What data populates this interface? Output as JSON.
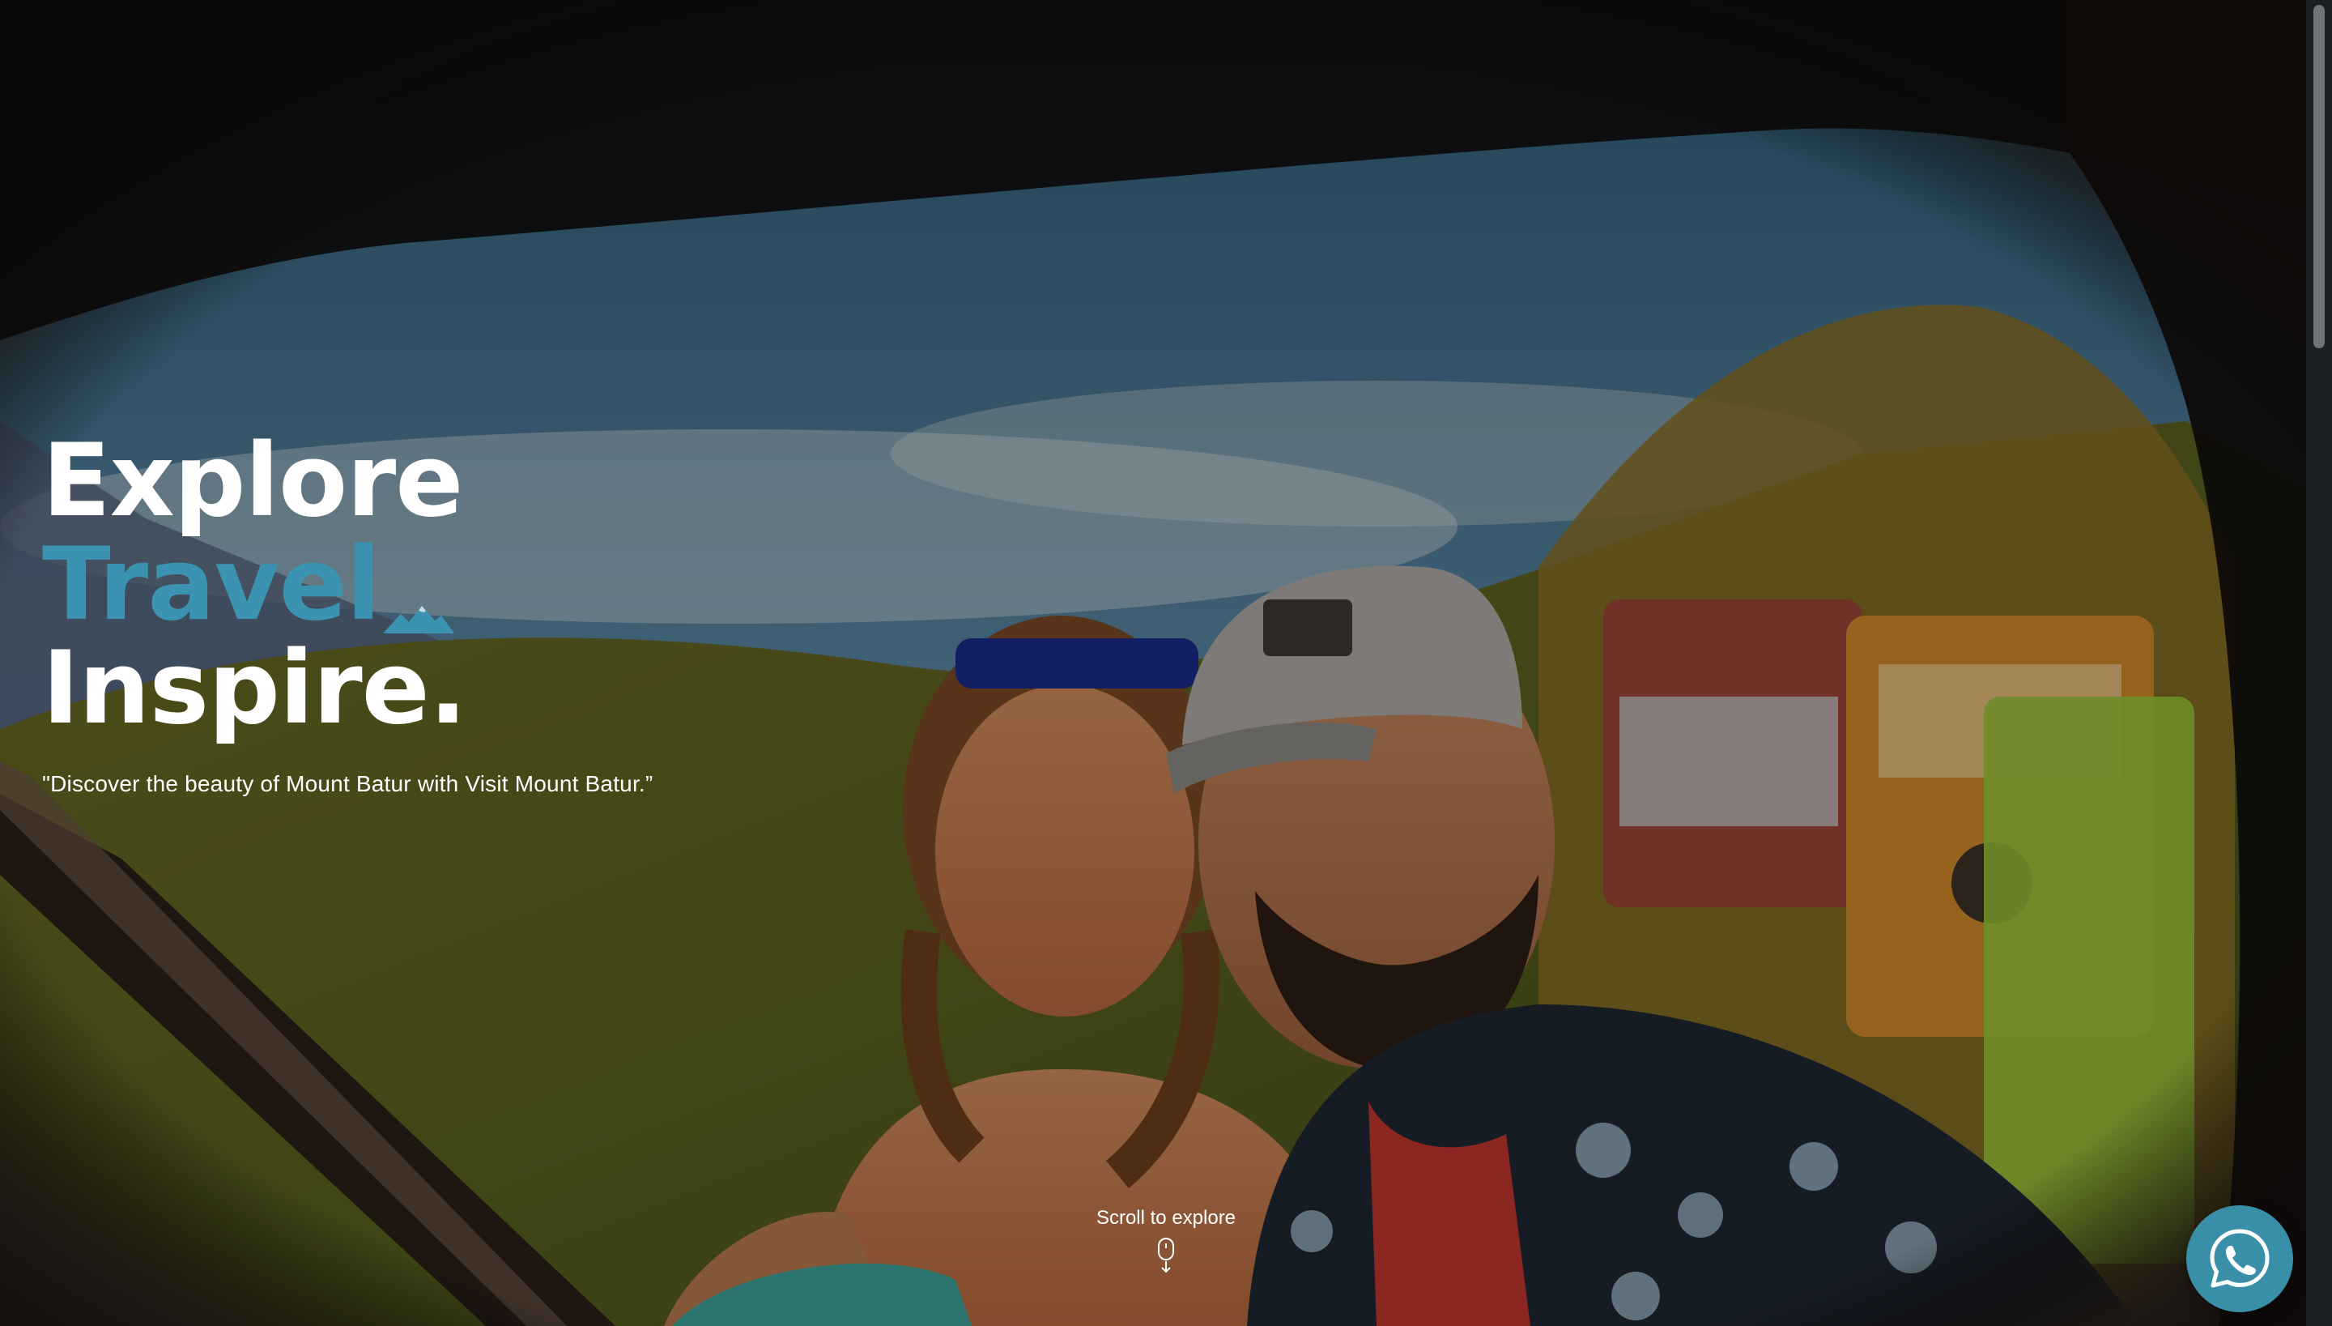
{
  "hero": {
    "line1": "Explore",
    "line2": "Travel",
    "line3": "Inspire.",
    "tagline": "\"Discover the beauty of Mount Batur with Visit Mount Batur.”",
    "accent_color": "#3c93b1",
    "accent_icon": "mountain-icon",
    "background": "photo of a smiling couple in front of jeeps on Mount Batur"
  },
  "scroll": {
    "label": "Scroll to explore",
    "icon": "mouse-scroll-icon"
  },
  "whatsapp": {
    "icon": "whatsapp-icon",
    "color": "#3a8fa8"
  }
}
